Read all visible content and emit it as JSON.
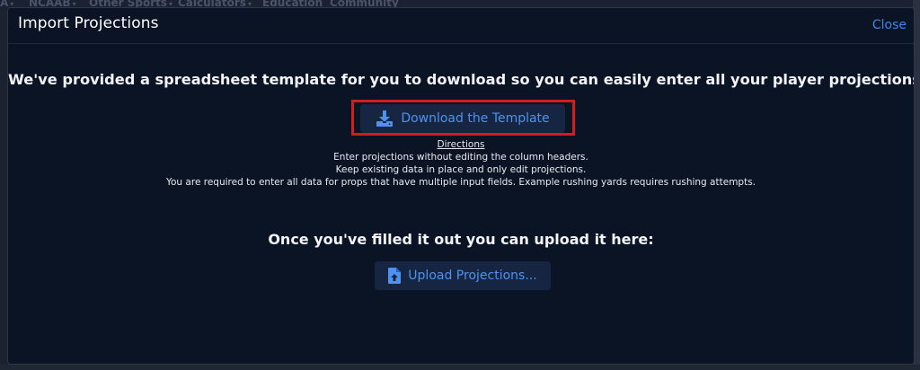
{
  "background_nav": {
    "items": [
      {
        "label": "A",
        "has_caret": true
      },
      {
        "label": "NCAAB",
        "has_caret": true
      },
      {
        "label": "Other Sports",
        "has_caret": true
      },
      {
        "label": "Calculators",
        "has_caret": true
      },
      {
        "label": "Education",
        "has_caret": false
      },
      {
        "label": "Community",
        "has_caret": false
      }
    ]
  },
  "modal": {
    "title": "Import Projections",
    "close_label": "Close",
    "intro": "We've provided a spreadsheet template for you to download so you can easily enter all your player projections:",
    "download_button": {
      "label": "Download the Template",
      "icon": "download-icon"
    },
    "directions": {
      "title": "Directions",
      "lines": [
        "Enter projections without editing the column headers.",
        "Keep existing data in place and only edit projections.",
        "You are required to enter all data for props that have multiple input fields. Example rushing yards requires rushing attempts."
      ]
    },
    "upload_prompt": "Once you've filled it out you can upload it here:",
    "upload_button": {
      "label": "Upload Projections...",
      "icon": "file-upload-icon"
    },
    "highlight_color": "#d01e1e",
    "accent_color": "#4d92f0"
  }
}
